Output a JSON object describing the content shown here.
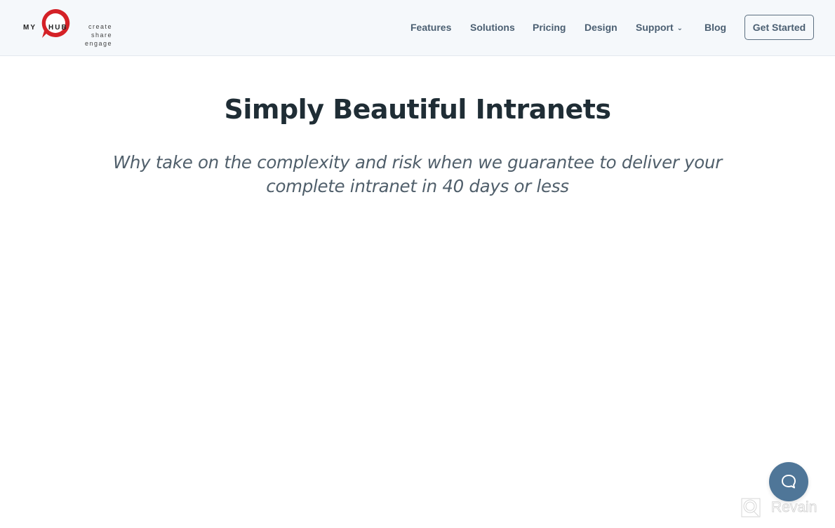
{
  "logo": {
    "left_word": "MY",
    "ring_word": "HUB",
    "tagline": [
      "create",
      "share",
      "engage"
    ],
    "brand_color": "#d42127"
  },
  "nav": {
    "items": [
      {
        "label": "Features"
      },
      {
        "label": "Solutions"
      },
      {
        "label": "Pricing"
      },
      {
        "label": "Design"
      },
      {
        "label": "Support",
        "has_dropdown": true,
        "dropdown_icon": "chevron-down-icon"
      },
      {
        "label": "Blog"
      }
    ],
    "cta_label": "Get Started"
  },
  "hero": {
    "title": "Simply Beautiful Intranets",
    "subtitle": "Why take on the complexity and risk when we guarantee to deliver your complete intranet in 40 days or less"
  },
  "chat_widget": {
    "icon": "chat-bubble-icon",
    "color": "#4f7698"
  },
  "watermark": {
    "text": "Revain",
    "icon": "revain-logo-icon"
  },
  "colors": {
    "header_bg": "#f5f8fb",
    "nav_text": "#4b5f72",
    "title_text": "#1f2d35",
    "subtitle_text": "#505f6b"
  }
}
